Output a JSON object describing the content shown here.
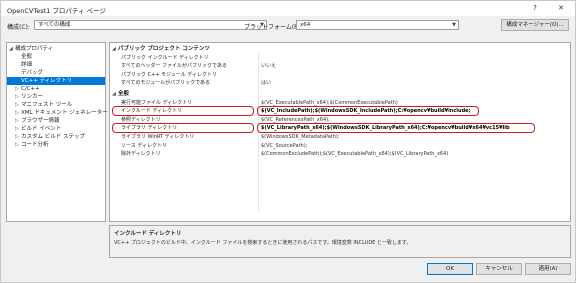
{
  "window": {
    "title": "OpenCVTest1 プロパティ ページ",
    "help_label": "?",
    "close_label": "✕"
  },
  "config_bar": {
    "config_label": "構成(C):",
    "config_value": "すべての構成",
    "platform_label": "プラットフォーム(P):",
    "platform_value": "x64",
    "config_manager_label": "構成マネージャー(O)..."
  },
  "tree": {
    "items": [
      {
        "label": "構成プロパティ",
        "expander": "◢"
      },
      {
        "label": "全般",
        "expander": ""
      },
      {
        "label": "詳細",
        "expander": ""
      },
      {
        "label": "デバッグ",
        "expander": ""
      },
      {
        "label": "VC++ ディレクトリ",
        "expander": "",
        "selected": true
      },
      {
        "label": "C/C++",
        "expander": "▷"
      },
      {
        "label": "リンカー",
        "expander": "▷"
      },
      {
        "label": "マニフェスト ツール",
        "expander": "▷"
      },
      {
        "label": "XML ドキュメント ジェネレーター",
        "expander": "▷"
      },
      {
        "label": "ブラウザー情報",
        "expander": "▷"
      },
      {
        "label": "ビルド イベント",
        "expander": "▷"
      },
      {
        "label": "カスタム ビルド ステップ",
        "expander": "▷"
      },
      {
        "label": "コード分析",
        "expander": "▷"
      }
    ]
  },
  "grid": {
    "categories": [
      {
        "label": "パブリック プロジェクト コンテンツ",
        "expander": "◢",
        "rows": [
          {
            "name": "パブリック インクルード ディレクトリ",
            "value": ""
          },
          {
            "name": "すべてのヘッダー ファイルがパブリックである",
            "value": "いいえ"
          },
          {
            "name": "パブリック C++ モジュール ディレクトリ",
            "value": ""
          },
          {
            "name": "すべてのモジュールがパブリックである",
            "value": "はい"
          }
        ]
      },
      {
        "label": "全般",
        "expander": "◢",
        "rows": [
          {
            "name": "実行可能ファイル ディレクトリ",
            "value": "$(VC_ExecutablePath_x64);$(CommonExecutablePath)"
          },
          {
            "name": "インクルード ディレクトリ",
            "value": "$(VC_IncludePath);$(WindowsSDK_IncludePath);C:¥opencv¥build¥include;"
          },
          {
            "name": "参照ディレクトリ",
            "value": "$(VC_ReferencesPath_x64);"
          },
          {
            "name": "ライブラリ ディレクトリ",
            "value": "$(VC_LibraryPath_x64);$(WindowsSDK_LibraryPath_x64);C:¥opencv¥build¥x64¥vc15¥lib"
          },
          {
            "name": "ライブラリ WinRT ディレクトリ",
            "value": "$(WindowsSDK_MetadataPath);"
          },
          {
            "name": "ソース ディレクトリ",
            "value": "$(VC_SourcePath);"
          },
          {
            "name": "除外ディレクトリ",
            "value": "$(CommonExcludePath);$(VC_ExecutablePath_x64);$(VC_LibraryPath_x64)"
          }
        ]
      }
    ]
  },
  "description": {
    "title": "インクルード ディレクトリ",
    "text": "VC++ プロジェクトのビルド中、インクルード ファイルを検索するときに使用されるパスです。環境変数 INCLUDE と一致します。"
  },
  "buttons": {
    "ok_label": "OK",
    "cancel_label": "キャンセル",
    "apply_label": "適用(A)"
  },
  "colors": {
    "selection": "#0078d7",
    "highlight_box": "#d01c1c"
  }
}
